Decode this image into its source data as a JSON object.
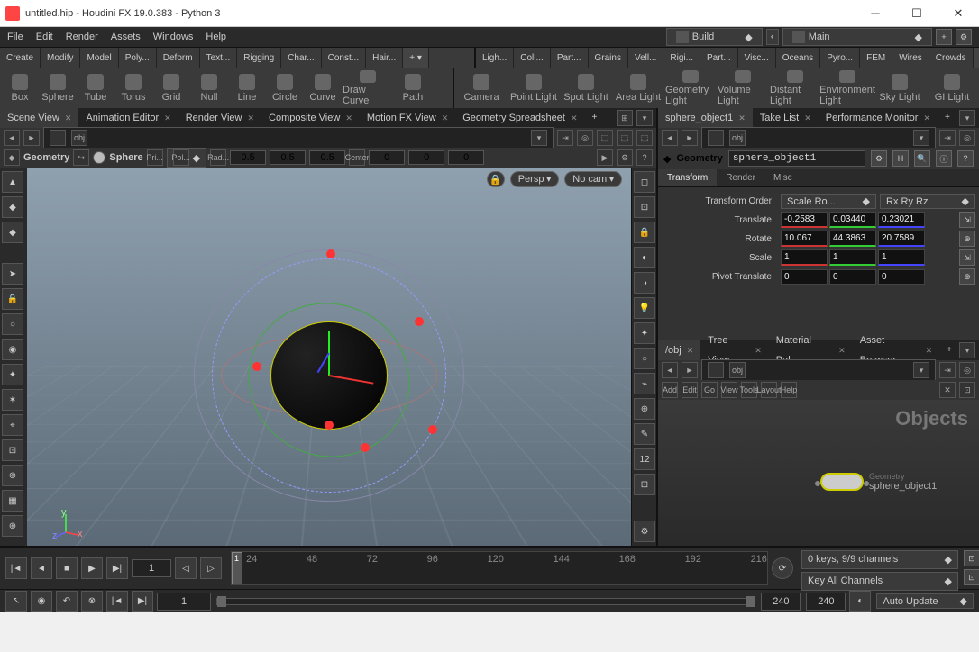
{
  "window": {
    "title": "untitled.hip - Houdini FX 19.0.383 - Python 3"
  },
  "menubar": [
    "File",
    "Edit",
    "Render",
    "Assets",
    "Windows",
    "Help"
  ],
  "desks": {
    "left": "Build",
    "right": "Main"
  },
  "shelf": {
    "left_tabs": [
      "Create",
      "Modify",
      "Model",
      "Poly...",
      "Deform",
      "Text...",
      "Rigging",
      "Char...",
      "Const...",
      "Hair..."
    ],
    "right_tabs": [
      "Ligh...",
      "Coll...",
      "Part...",
      "Grains",
      "Vell...",
      "Rigi...",
      "Part...",
      "Visc...",
      "Oceans",
      "Pyro...",
      "FEM",
      "Wires",
      "Crowds"
    ],
    "left_items": [
      "Box",
      "Sphere",
      "Tube",
      "Torus",
      "Grid",
      "Null",
      "Line",
      "Circle",
      "Curve",
      "Draw Curve",
      "Path"
    ],
    "right_items": [
      "Camera",
      "Point Light",
      "Spot Light",
      "Area Light",
      "Geometry Light",
      "Volume Light",
      "Distant Light",
      "Environment Light",
      "Sky Light",
      "GI Light"
    ]
  },
  "scene_pane": {
    "tabs": [
      "Scene View",
      "Animation Editor",
      "Render View",
      "Composite View",
      "Motion FX View",
      "Geometry Spreadsheet"
    ],
    "path": "obj",
    "op_left": "Geometry",
    "op_right": "Sphere",
    "primlabel": "Pri...",
    "poly": "Pol...",
    "radlabel": "Rad...",
    "rad": [
      "0.5",
      "0.5",
      "0.5"
    ],
    "centerlabel": "Center",
    "center": [
      "0",
      "0",
      "0"
    ],
    "persp": "Persp",
    "nocam": "No cam"
  },
  "parm_pane": {
    "tabs": [
      "sphere_object1",
      "Take List",
      "Performance Monitor"
    ],
    "path": "obj",
    "type": "Geometry",
    "name": "sphere_object1",
    "folders": [
      "Transform",
      "Render",
      "Misc"
    ],
    "xform_order_label": "Transform Order",
    "xform_order": "Scale Ro...",
    "rot_order": "Rx Ry Rz",
    "translate_label": "Translate",
    "translate": [
      "-0.2583",
      "0.03440",
      "0.23021"
    ],
    "rotate_label": "Rotate",
    "rotate": [
      "10.067",
      "44.3863",
      "20.7589"
    ],
    "scale_label": "Scale",
    "scale": [
      "1",
      "1",
      "1"
    ],
    "pivot_label": "Pivot Translate",
    "pivot": [
      "0",
      "0",
      "0"
    ]
  },
  "net_pane": {
    "tabs": [
      "/obj",
      "Tree View",
      "Material Pal...",
      "Asset Browser"
    ],
    "path": "obj",
    "menus": [
      "Add",
      "Edit",
      "Go",
      "View",
      "Tools",
      "Layout",
      "Help"
    ],
    "context": "Objects",
    "node_type": "Geometry",
    "node_name": "sphere_object1"
  },
  "timeline": {
    "cur": "1",
    "ticks": [
      "24",
      "48",
      "72",
      "96",
      "120",
      "144",
      "168",
      "192",
      "216"
    ],
    "range_start": "1",
    "range_end": "240",
    "global_end": "240",
    "keys": "0 keys, 9/9 channels",
    "keyall": "Key All Channels",
    "update": "Auto Update"
  }
}
